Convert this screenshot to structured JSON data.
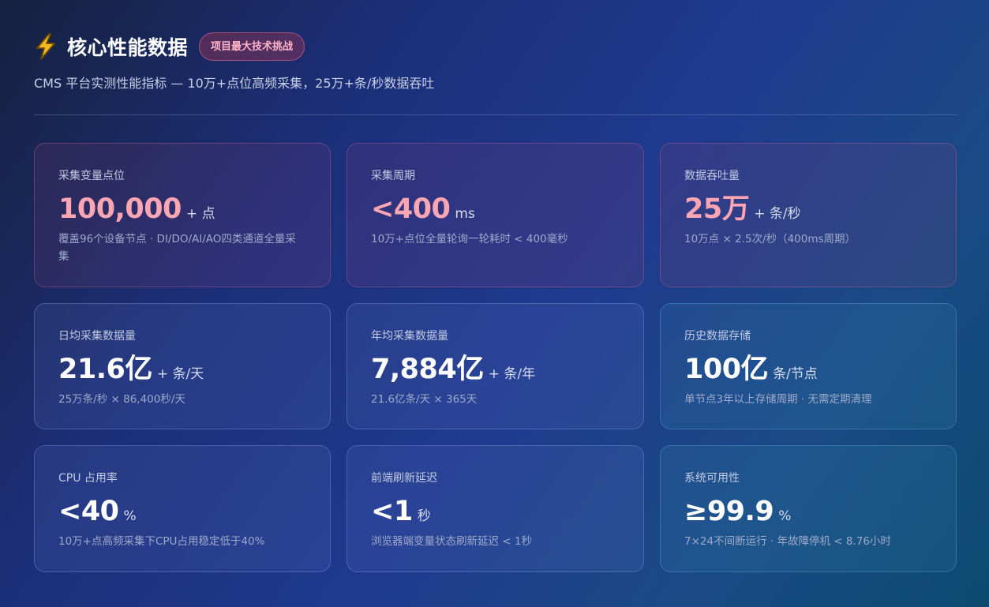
{
  "header": {
    "icon": "lightning-bolt-icon",
    "title": "核心性能数据",
    "badge": "项目最大技术挑战",
    "subtitle": "CMS 平台实测性能指标 — 10万+点位高频采集，25万+条/秒数据吞吐"
  },
  "colors": {
    "accent_pink": "#fca5b3",
    "badge_text": "#ffb3c6",
    "value_white": "#ffffff"
  },
  "cards": [
    {
      "label": "采集变量点位",
      "value": "100,000",
      "unit": "+ 点",
      "desc": "覆盖96个设备节点 · DI/DO/AI/AO四类通道全量采集"
    },
    {
      "label": "采集周期",
      "value": "<400",
      "unit": "ms",
      "desc": "10万+点位全量轮询一轮耗时 < 400毫秒"
    },
    {
      "label": "数据吞吐量",
      "value": "25万",
      "unit": "+ 条/秒",
      "desc": "10万点 × 2.5次/秒（400ms周期）"
    },
    {
      "label": "日均采集数据量",
      "value": "21.6亿",
      "unit": "+ 条/天",
      "desc": "25万条/秒 × 86,400秒/天"
    },
    {
      "label": "年均采集数据量",
      "value": "7,884亿",
      "unit": "+ 条/年",
      "desc": "21.6亿条/天 × 365天"
    },
    {
      "label": "历史数据存储",
      "value": "100亿",
      "unit": "条/节点",
      "desc": "单节点3年以上存储周期 · 无需定期清理"
    },
    {
      "label": "CPU 占用率",
      "value": "<40",
      "unit": "%",
      "desc": "10万+点高频采集下CPU占用稳定低于40%"
    },
    {
      "label": "前端刷新延迟",
      "value": "<1",
      "unit": "秒",
      "desc": "浏览器端变量状态刷新延迟 < 1秒"
    },
    {
      "label": "系统可用性",
      "value": "≥99.9",
      "unit": "%",
      "desc": "7×24不间断运行 · 年故障停机 < 8.76小时"
    }
  ]
}
